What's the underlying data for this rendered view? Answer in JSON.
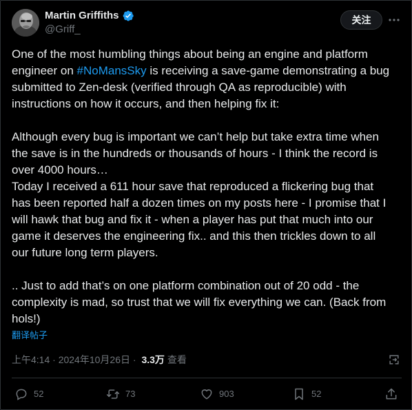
{
  "author": {
    "display_name": "Martin Griffiths",
    "handle": "@Griff_",
    "verified_color": "#1d9bf0",
    "avatar_icon": "avatar-bald-man-glasses"
  },
  "header": {
    "follow_label": "关注",
    "more_icon": "more-icon"
  },
  "tweet": {
    "line1_before": "One of the most humbling things about being an engine and platform\nengineer on ",
    "hashtag": "#NoMansSky",
    "line1_after": " is receiving a save-game demonstrating a bug\nsubmitted to Zen-desk (verified through QA as reproducible) with\ninstructions on how it occurs, and then helping fix it:\n\nAlthough every bug is important we can’t help but take extra time when\nthe save is in the hundreds or thousands of hours - I think the record is\nover 4000 hours…\nToday I received a 611 hour save that reproduced a flickering bug that\nhas been reported half a dozen times on my posts here - I promise that I\nwill hawk that bug and fix it - when a player has put that much into our\ngame it deserves the engineering fix.. and this then trickles down to all\nour future long term players.\n\n.. Just to add that’s on one platform combination out of 20 odd - the\ncomplexity is mad, so trust that we will fix everything we can. (Back from\nhols!)",
    "translate_label": "翻译帖子",
    "link_color": "#1d9bf0"
  },
  "meta": {
    "time": "上午4:14",
    "separator": " · ",
    "date": "2024年10月26日",
    "separator2": " · ",
    "views_count": "3.3万",
    "views_label": "查看"
  },
  "actions": {
    "replies": "52",
    "reposts": "73",
    "likes": "903",
    "bookmarks": "52"
  }
}
